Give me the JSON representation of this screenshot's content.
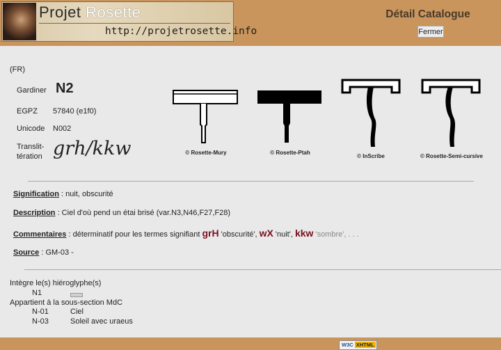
{
  "header": {
    "logo_title_a": "Projet ",
    "logo_title_b": "Rosette",
    "logo_url": "http://projetrosette.info",
    "catalog_title": "Détail Catalogue",
    "close_label": "Fermer"
  },
  "entry": {
    "lang": "(FR)",
    "gardiner_label": "Gardiner",
    "gardiner_value": "N2",
    "egpz_label": "EGPZ",
    "egpz_value": "57840 (e1f0)",
    "unicode_label": "Unicode",
    "unicode_value": "N002",
    "translit_label_1": "Translit-",
    "translit_label_2": "tération",
    "translit_value": "grh/kkw"
  },
  "glyphs": [
    {
      "credit": "© Rosette-Mury"
    },
    {
      "credit": "© Rosette-Ptah"
    },
    {
      "credit": "© InScribe"
    },
    {
      "credit": "© Rosette-Semi-cursive"
    }
  ],
  "details": {
    "signification_key": "Signification",
    "signification_text": " : nuit, obscurité",
    "description_key": "Description",
    "description_text": " : Ciel d'où pend un étai brisé (var.N3,N46,F27,F28)",
    "commentaires_key": "Commentaires",
    "commentaires_text": " : déterminatif pour les termes signifiant ",
    "term1": "grH",
    "gloss1": " 'obscurité', ",
    "term2": "wX",
    "gloss2": " 'nuit', ",
    "term3": "kkw",
    "gloss3": " 'sombre'",
    "tail": ", . . .",
    "source_key": "Source",
    "source_text": " : GM-03 -"
  },
  "relations": {
    "integrates_label": "Intègre le(s) hiéroglyphe(s)",
    "integrates": [
      {
        "code": "N1"
      }
    ],
    "section_label": "Appartient à la sous-section MdC",
    "sections": [
      {
        "code": "N-01",
        "name": "Ciel"
      },
      {
        "code": "N-03",
        "name": "Soleil avec uraeus"
      }
    ]
  },
  "footer": {
    "badge_w3c": "W3C",
    "badge_xhtml": "XHTML"
  }
}
